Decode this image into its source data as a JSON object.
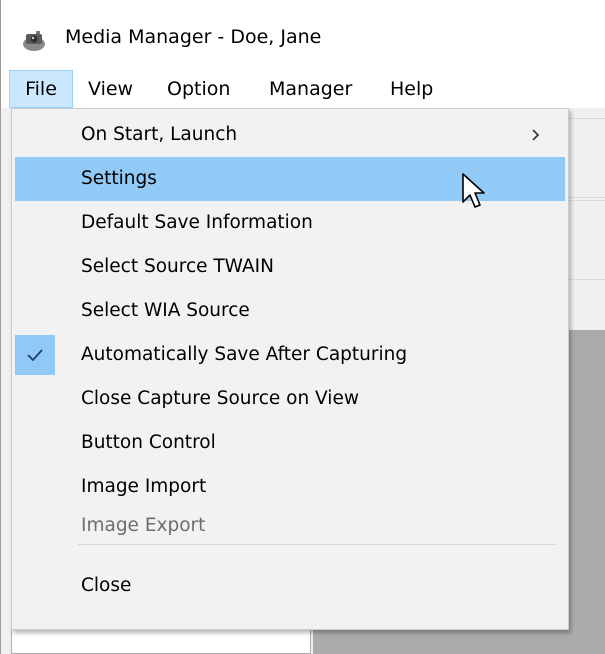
{
  "window": {
    "title": "Media Manager - Doe, Jane",
    "app_icon": "media-manager-app-icon"
  },
  "menubar": {
    "items": [
      {
        "label": "File",
        "active": true
      },
      {
        "label": "View",
        "active": false
      },
      {
        "label": "Option",
        "active": false
      },
      {
        "label": "Manager",
        "active": false
      },
      {
        "label": "Help",
        "active": false
      }
    ]
  },
  "file_menu": {
    "items": [
      {
        "label": "On Start, Launch",
        "has_submenu": true,
        "icon": "chevron-right-icon"
      },
      {
        "label": "Settings",
        "highlighted": true
      },
      {
        "label": "Default Save Information"
      },
      {
        "label": "Select Source TWAIN"
      },
      {
        "label": "Select WIA Source"
      },
      {
        "label": "Automatically Save After Capturing",
        "checked": true,
        "icon": "checkmark-icon"
      },
      {
        "label": "Close Capture Source on View"
      },
      {
        "label": "Button Control"
      },
      {
        "label": "Image Import"
      },
      {
        "label": "Image Export",
        "disabled": true
      },
      {
        "label": "Close"
      }
    ]
  },
  "colors": {
    "menu_highlight": "#91c9f7",
    "menubar_active": "#cce8ff",
    "menu_background": "#f2f2f2",
    "disabled_text": "#6d6d6d",
    "canvas_gray": "#ababab"
  },
  "cursor": {
    "icon": "arrow-cursor-icon"
  }
}
